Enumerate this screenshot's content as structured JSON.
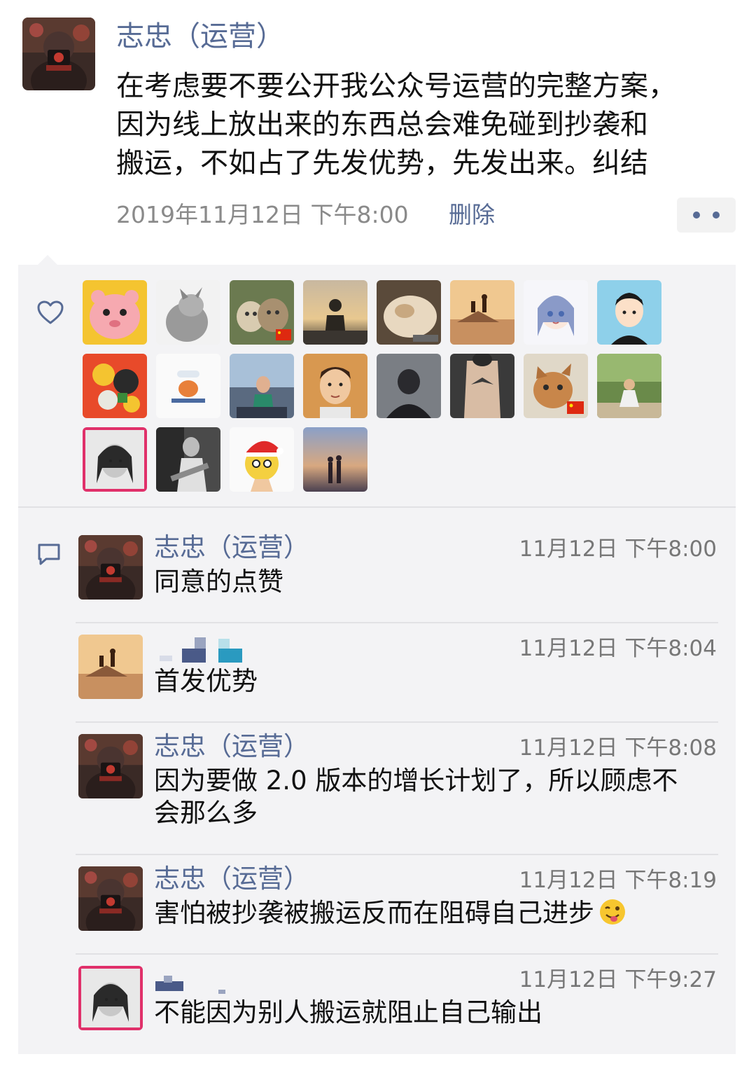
{
  "post": {
    "author": "志忠（运营）",
    "text_lines": [
      "在考虑要不要公开我公众号运营的完整方案，",
      "因为线上放出来的东西总会难免碰到抄袭和",
      "搬运，不如占了先发优势，先发出来。纠结"
    ],
    "timestamp": "2019年11月12日 下午8:00",
    "delete_label": "删除"
  },
  "likes": {
    "icon": "heart-outline-icon",
    "liker_avatars": [
      "pink-cartoon-avatar",
      "cat-looking-up-avatar",
      "two-cats-avatar",
      "sunset-silhouette-avatar",
      "fat-cat-avatar",
      "desert-horse-avatar",
      "anime-girl-avatar",
      "cartoon-boy-avatar",
      "colorful-illustration-avatar",
      "cat-drawing-avatar",
      "city-woman-avatar",
      "man-portrait-avatar",
      "dark-silhouette-avatar",
      "back-tattoo-avatar",
      "orange-cat-avatar",
      "park-sitting-avatar",
      "girl-bw-pink-frame-avatar",
      "guitar-player-avatar",
      "christmas-emoji-avatar",
      "sunset-couple-avatar"
    ]
  },
  "comments": [
    {
      "name": "志忠（运营）",
      "time": "11月12日 下午8:00",
      "lines": [
        "同意的点赞"
      ],
      "avatar": "post-author-avatar",
      "name_blurred": false
    },
    {
      "name": "",
      "time": "11月12日 下午8:04",
      "lines": [
        "首发优势"
      ],
      "avatar": "desert-horse-avatar",
      "name_blurred": true
    },
    {
      "name": "志忠（运营）",
      "time": "11月12日 下午8:08",
      "lines": [
        "因为要做 2.0 版本的增长计划了，所以顾虑不",
        "会那么多"
      ],
      "avatar": "post-author-avatar",
      "name_blurred": false
    },
    {
      "name": "志忠（运营）",
      "time": "11月12日 下午8:19",
      "lines": [
        "害怕被抄袭被搬运反而在阻碍自己进步"
      ],
      "avatar": "post-author-avatar",
      "name_blurred": false,
      "trailing_emoji": "winking-tongue-emoji"
    },
    {
      "name": "",
      "time": "11月12日 下午9:27",
      "lines": [
        "不能因为别人搬运就阻止自己输出"
      ],
      "avatar": "girl-bw-pink-frame-avatar",
      "name_blurred": true
    }
  ],
  "colors": {
    "link": "#576b95",
    "interaction_bg": "#f3f3f5",
    "meta": "#8a8a8a"
  }
}
